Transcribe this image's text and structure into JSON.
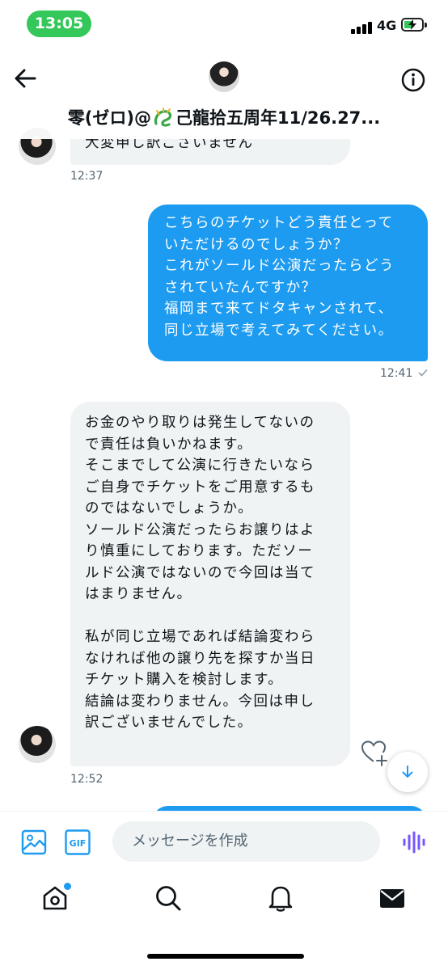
{
  "status_bar": {
    "time": "13:05",
    "network": "4G"
  },
  "header": {
    "title_before": "零(ゼロ)@",
    "title_after": "己龍拾五周年11/26.27..."
  },
  "messages": [
    {
      "side": "received",
      "text": "大変申し訳ございません",
      "time": "12:37"
    },
    {
      "side": "sent",
      "text": "こちらのチケットどう責任とって\nいただけるのでしょうか？\nこれがソールド公演だったらどう\nされていたんですか？\n福岡まで来てドタキャンされて、\n同じ立場で考えてみてください。",
      "time": "12:41"
    },
    {
      "side": "received",
      "text": "お金のやり取りは発生してないの\nで責任は負いかねます。\nそこまでして公演に行きたいなら\nご自身でチケットをご用意するも\nのではないでしょうか。\nソールド公演だったらお譲りはよ\nり慎重にしております。ただソー\nルド公演ではないので今回は当て\nはまりません。\n\n私が同じ立場であれば結論変わら\nなければ他の譲り先を探すか当日\nチケット購入を検討します。\n結論は変わりません。今回は申し\n訳ございませんでした。",
      "time": "12:52"
    }
  ],
  "composer": {
    "placeholder": "メッセージを作成",
    "gif_label": "GIF"
  },
  "colors": {
    "accent": "#1d9bf0",
    "received_bubble": "#eff3f4",
    "voice": "#7856ff",
    "time_pill": "#34c759"
  },
  "icons": [
    "back-arrow-icon",
    "info-icon",
    "image-icon",
    "gif-icon",
    "voice-icon",
    "heart-plus-icon",
    "arrow-down-icon",
    "home-icon",
    "search-icon",
    "bell-icon",
    "mail-icon"
  ]
}
